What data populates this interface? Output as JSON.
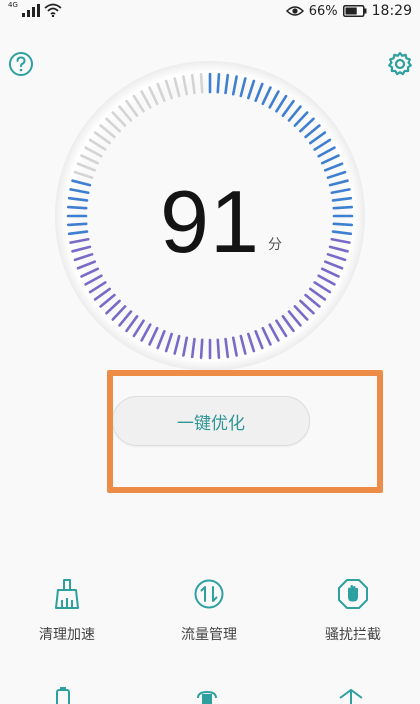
{
  "status_bar": {
    "network_type": "4G",
    "battery_percent": "66%",
    "battery_level": 0.66,
    "time": "18:29"
  },
  "icons": {
    "help": "help-circle-icon",
    "settings": "gear-icon"
  },
  "score": {
    "value": "91",
    "unit": "分",
    "progress": 0.91
  },
  "optimize_button": {
    "label": "一键优化"
  },
  "tools": [
    {
      "label": "清理加速",
      "icon": "broom-icon"
    },
    {
      "label": "流量管理",
      "icon": "data-traffic-icon"
    },
    {
      "label": "骚扰拦截",
      "icon": "hand-block-icon"
    }
  ],
  "colors": {
    "accent_teal": "#2fa0a0",
    "gauge_blue": "#3f7fd0",
    "gauge_purple": "#7a6ac8",
    "gauge_inactive": "#d4d4d4",
    "highlight_orange": "#ec8c47"
  }
}
